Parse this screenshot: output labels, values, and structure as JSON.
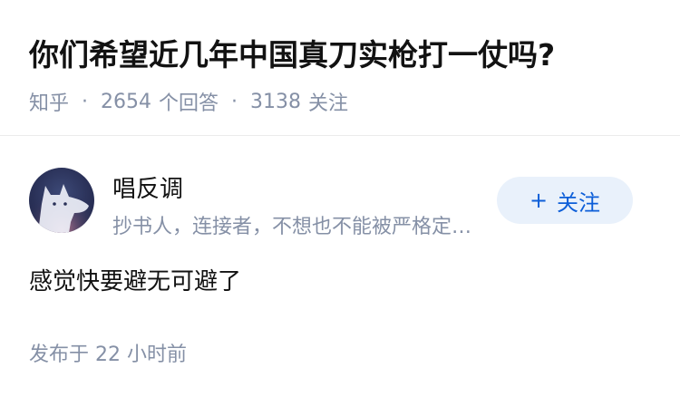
{
  "question": {
    "title": "你们希望近几年中国真刀实枪打一仗吗?",
    "source": "知乎",
    "separator": "·",
    "answer_count": "2654",
    "answer_label": "个回答",
    "follower_count": "3138",
    "follower_label": "关注"
  },
  "answer": {
    "author": {
      "avatar_icon": "dog-silhouette-avatar",
      "name": "唱反调",
      "headline": "抄书人，连接者，不想也不能被严格定义的人"
    },
    "follow_button": {
      "icon": "+",
      "label": "关注"
    },
    "content": "感觉快要避无可避了",
    "publish_time": "发布于 22 小时前"
  },
  "colors": {
    "title": "#121212",
    "meta": "#8590a6",
    "follow_bg": "#e9f1fb",
    "follow_text": "#0d5ed8",
    "divider": "#ebebeb"
  }
}
